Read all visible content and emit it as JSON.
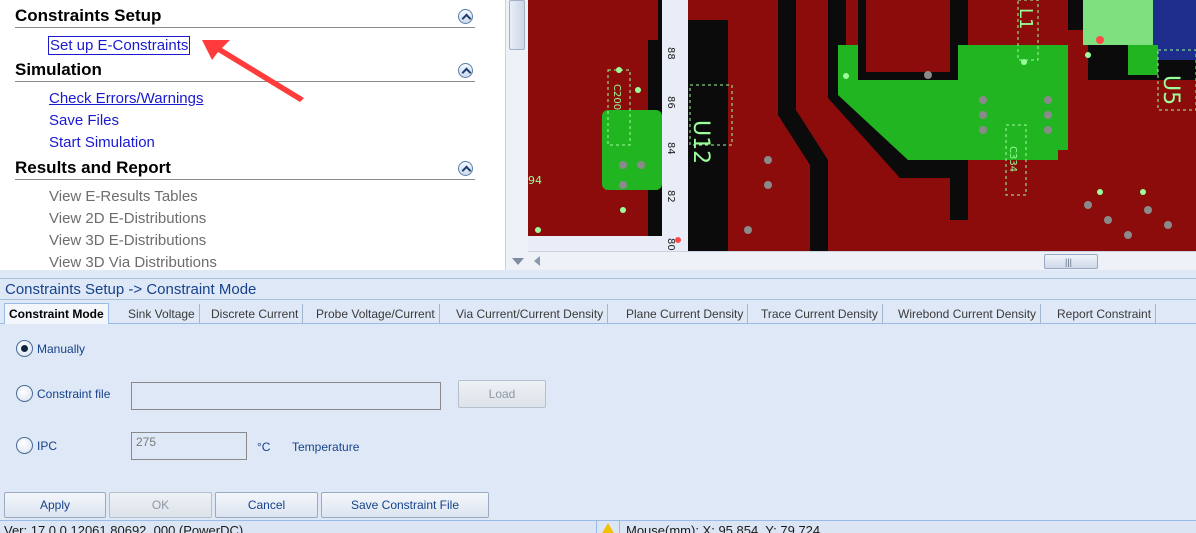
{
  "workflow": {
    "sections": [
      {
        "title": "Constraints Setup",
        "items": [
          {
            "label": "Set up E-Constraints",
            "enabled": true
          }
        ]
      },
      {
        "title": "Simulation",
        "items": [
          {
            "label": "Check Errors/Warnings",
            "enabled": true
          },
          {
            "label": "Save Files",
            "enabled": true
          },
          {
            "label": "Start Simulation",
            "enabled": true
          }
        ]
      },
      {
        "title": "Results and Report",
        "items": [
          {
            "label": "View E-Results Tables",
            "enabled": false
          },
          {
            "label": "View 2D E-Distributions",
            "enabled": false
          },
          {
            "label": "View 3D E-Distributions",
            "enabled": false
          },
          {
            "label": "View 3D Via Distributions",
            "enabled": false
          }
        ]
      }
    ]
  },
  "pcb": {
    "ruler_ticks": [
      "88",
      "86",
      "84",
      "82",
      "80"
    ],
    "component_labels": [
      "U12",
      "U5",
      "L1",
      "C200",
      "C334",
      "94"
    ]
  },
  "panel": {
    "title": "Constraints Setup -> Constraint Mode",
    "tabs": [
      {
        "label": "Constraint Mode",
        "active": true
      },
      {
        "label": "Sink Voltage",
        "active": false
      },
      {
        "label": "Discrete Current",
        "active": false
      },
      {
        "label": "Probe Voltage/Current",
        "active": false
      },
      {
        "label": "Via Current/Current Density",
        "active": false
      },
      {
        "label": "Plane Current Density",
        "active": false
      },
      {
        "label": "Trace Current Density",
        "active": false
      },
      {
        "label": "Wirebond Current Density",
        "active": false
      },
      {
        "label": "Report Constraint",
        "active": false
      }
    ],
    "modes": {
      "manually_label": "Manually",
      "constraint_file_label": "Constraint file",
      "ipc_label": "IPC",
      "selected": "Manually"
    },
    "constraint_file_value": "",
    "load_button": "Load",
    "ipc_value": "275",
    "ipc_unit": "°C",
    "temperature_label": "Temperature",
    "buttons": {
      "apply": "Apply",
      "ok": "OK",
      "cancel": "Cancel",
      "save": "Save Constraint File"
    }
  },
  "status": {
    "version": "Ver: 17.0.0.12061.80692 .000 (PowerDC)",
    "mouse": "Mouse(mm): X: 95.854, Y: 79.724"
  },
  "colors": {
    "accent": "#15428b",
    "link": "#1a1ad0",
    "annotation_arrow": "#ff3b3b",
    "pcb_red": "#8c0c0c",
    "pcb_green": "#22b522"
  }
}
